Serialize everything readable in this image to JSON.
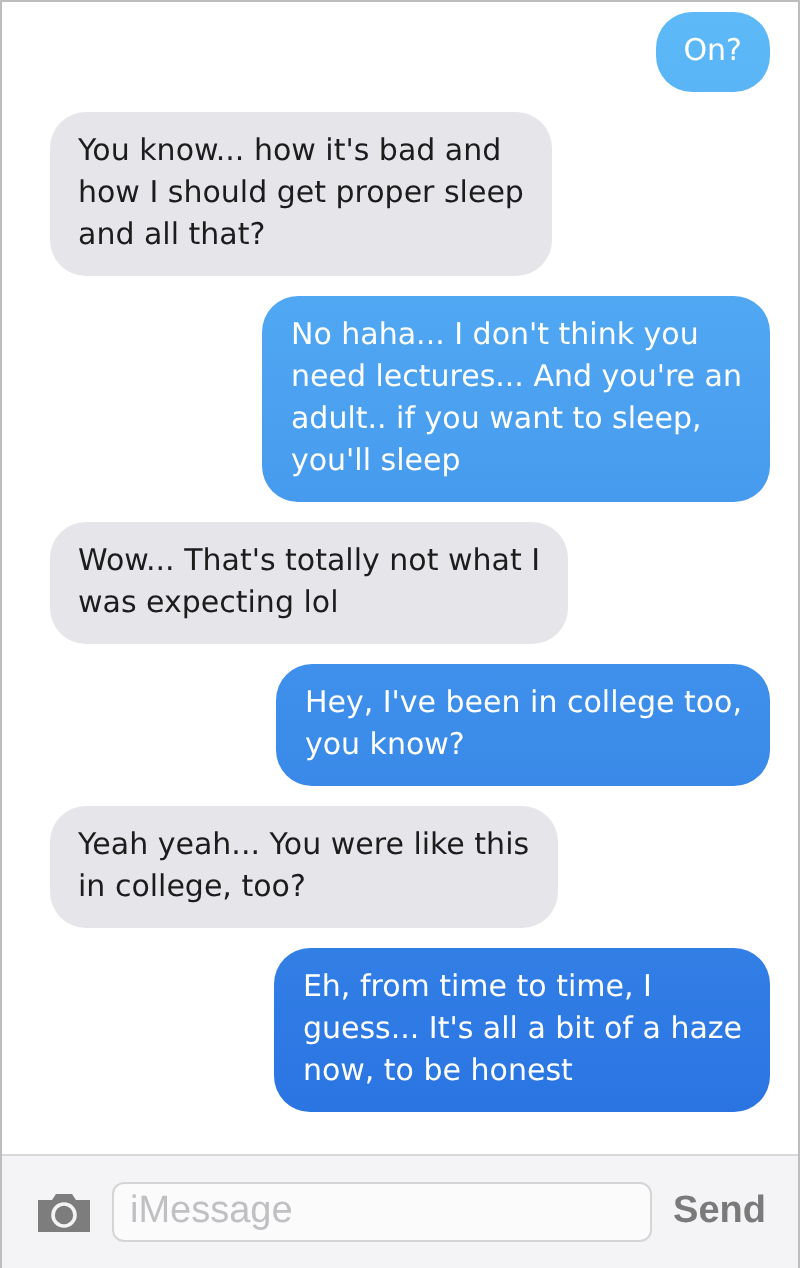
{
  "messages": [
    {
      "kind": "sent",
      "text": "On?"
    },
    {
      "kind": "received",
      "text": "You know... how it's bad and\nhow I should get proper sleep\nand all that?"
    },
    {
      "kind": "sent",
      "text": "No haha... I don't think you\nneed lectures... And you're an\nadult.. if you want to sleep,\nyou'll sleep"
    },
    {
      "kind": "received",
      "text": "Wow... That's totally not what I\nwas expecting lol"
    },
    {
      "kind": "sent",
      "text": "Hey, I've been in college too,\nyou know?"
    },
    {
      "kind": "received",
      "text": "Yeah yeah... You were like this\nin college, too?"
    },
    {
      "kind": "sent",
      "text": "Eh, from time to time, I\nguess... It's all a bit of a haze\nnow, to be honest"
    }
  ],
  "composer": {
    "placeholder": "iMessage",
    "send_label": "Send"
  }
}
